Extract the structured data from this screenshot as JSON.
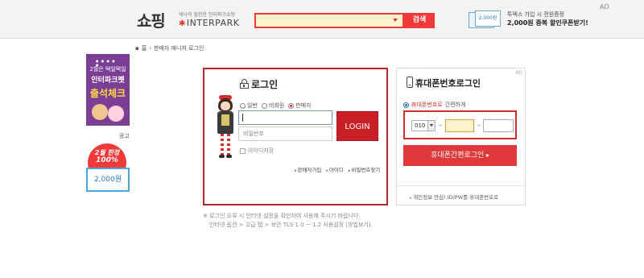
{
  "header": {
    "logo_korean": "쇼핑",
    "logo_tagline": "세나의 절친한 인터파크쇼핑",
    "logo_brand": "INTERPARK",
    "search_button": "검색",
    "coupon_text": "2,000원",
    "promo_line1": "투덱스 가입 시 전원증정",
    "promo_line2": "2,000원 중복 할인쿠폰받기!",
    "ad_label": "AD"
  },
  "breadcrumb": {
    "home": "홈",
    "current": "판매자 매니저 로그인"
  },
  "left_banners": {
    "banner1_line1": "2월은 택일택일",
    "banner1_line2": "인터파크펫",
    "banner1_line3": "출석체크",
    "ad_label": "광고",
    "banner2_line1": "2월 한정",
    "banner2_line2": "100%",
    "banner2_coupon": "2,000원"
  },
  "login": {
    "title": "로그인",
    "radio_options": [
      {
        "label": "일반",
        "selected": false
      },
      {
        "label": "비회원",
        "selected": false
      },
      {
        "label": "판매자",
        "selected": true
      }
    ],
    "id_value": "",
    "pw_placeholder": "비밀번호",
    "login_button": "LOGIN",
    "save_id": "아이디저장",
    "links": [
      "판매자가입",
      "아이디",
      "비밀번호찾기"
    ]
  },
  "phone_login": {
    "ad_label": "AD",
    "title": "휴대폰번호로그인",
    "radio_label_highlight": "휴대폰번호로",
    "radio_label_rest": " 간편하게",
    "prefix": "010",
    "middle": "",
    "last": "",
    "button": "휴대폰간편로그인",
    "footer": "개인정보 안심! ID/PW를 휴대폰번호로"
  },
  "notice": {
    "line1": "※ 로그인 오류 시 인터넷 설정을 확인하여 사용해 주시기 바랍니다.",
    "line2": "인터넷 옵션 > 고급 탭 > 보안 TLS 1.0 ~ 1.2 사용설정 [방법보기]"
  },
  "colors": {
    "brand_red": "#ef3a39",
    "login_red": "#c81e24",
    "box_border": "#b9262b",
    "search_bg": "#fdf3cf"
  }
}
